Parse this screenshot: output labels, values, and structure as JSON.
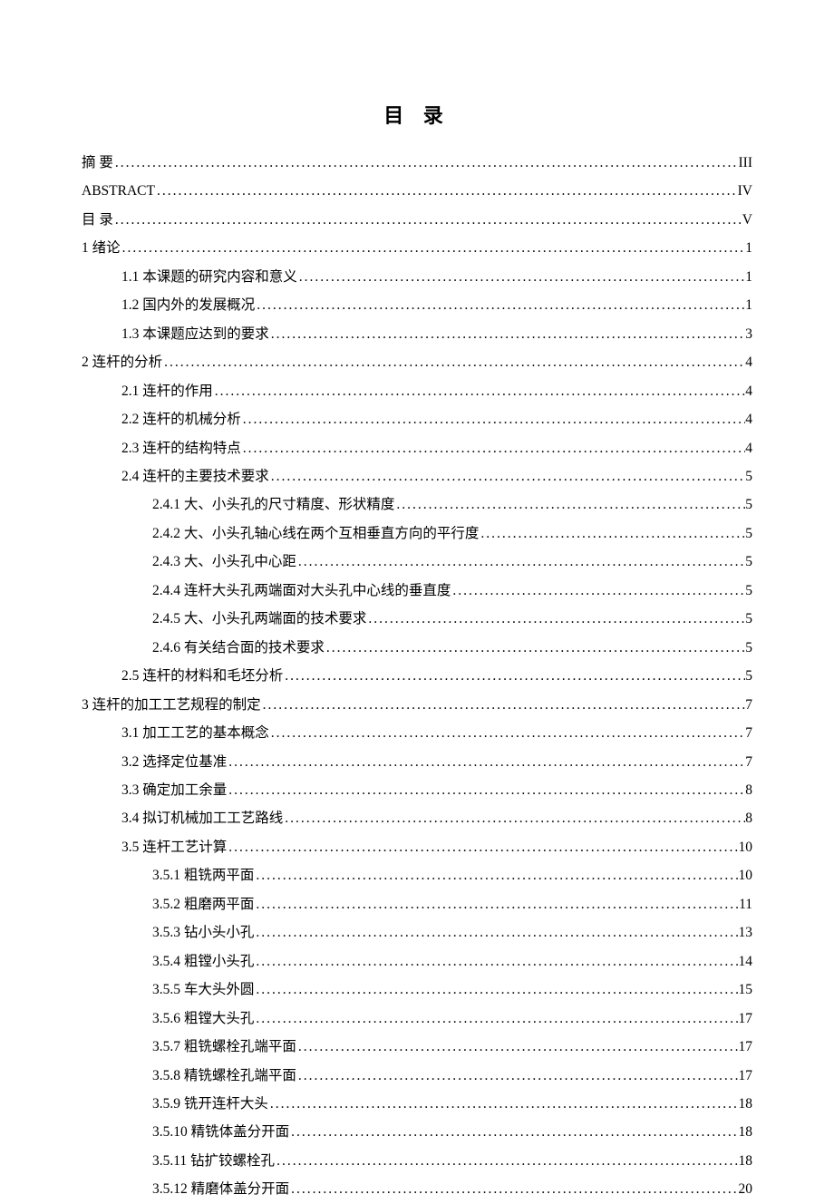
{
  "heading": "目  录",
  "toc": [
    {
      "level": 0,
      "title": "摘    要",
      "page": "III"
    },
    {
      "level": 0,
      "title": "ABSTRACT",
      "page": "IV"
    },
    {
      "level": 0,
      "title": "目    录",
      "page": "V"
    },
    {
      "level": 0,
      "title": "1  绪论",
      "page": "1"
    },
    {
      "level": 1,
      "title": "1.1  本课题的研究内容和意义",
      "page": "1"
    },
    {
      "level": 1,
      "title": "1.2  国内外的发展概况",
      "page": "1"
    },
    {
      "level": 1,
      "title": "1.3  本课题应达到的要求",
      "page": "3"
    },
    {
      "level": 0,
      "title": "2  连杆的分析",
      "page": "4"
    },
    {
      "level": 1,
      "title": "2.1  连杆的作用",
      "page": "4"
    },
    {
      "level": 1,
      "title": "2.2  连杆的机械分析",
      "page": "4"
    },
    {
      "level": 1,
      "title": "2.3  连杆的结构特点",
      "page": "4"
    },
    {
      "level": 1,
      "title": "2.4 连杆的主要技术要求",
      "page": "5"
    },
    {
      "level": 2,
      "title": "2.4.1  大、小头孔的尺寸精度、形状精度",
      "page": "5"
    },
    {
      "level": 2,
      "title": "2.4.2  大、小头孔轴心线在两个互相垂直方向的平行度",
      "page": "5"
    },
    {
      "level": 2,
      "title": "2.4.3  大、小头孔中心距",
      "page": "5"
    },
    {
      "level": 2,
      "title": "2.4.4  连杆大头孔两端面对大头孔中心线的垂直度",
      "page": "5"
    },
    {
      "level": 2,
      "title": "2.4.5  大、小头孔两端面的技术要求",
      "page": "5"
    },
    {
      "level": 2,
      "title": "2.4.6  有关结合面的技术要求",
      "page": "5"
    },
    {
      "level": 1,
      "title": "2.5  连杆的材料和毛坯分析",
      "page": "5"
    },
    {
      "level": 0,
      "title": "3  连杆的加工工艺规程的制定",
      "page": "7"
    },
    {
      "level": 1,
      "title": "3.1  加工工艺的基本概念",
      "page": "7"
    },
    {
      "level": 1,
      "title": "3.2  选择定位基准",
      "page": "7"
    },
    {
      "level": 1,
      "title": "3.3  确定加工余量",
      "page": "8"
    },
    {
      "level": 1,
      "title": "3.4  拟订机械加工工艺路线",
      "page": "8"
    },
    {
      "level": 1,
      "title": "3.5  连杆工艺计算",
      "page": "10"
    },
    {
      "level": 2,
      "title": "3.5.1  粗铣两平面",
      "page": "10"
    },
    {
      "level": 2,
      "title": "3.5.2  粗磨两平面",
      "page": "11"
    },
    {
      "level": 2,
      "title": "3.5.3  钻小头小孔",
      "page": "13"
    },
    {
      "level": 2,
      "title": "3.5.4  粗镗小头孔",
      "page": "14"
    },
    {
      "level": 2,
      "title": "3.5.5  车大头外圆",
      "page": "15"
    },
    {
      "level": 2,
      "title": "3.5.6  粗镗大头孔",
      "page": "17"
    },
    {
      "level": 2,
      "title": "3.5.7  粗铣螺栓孔端平面",
      "page": "17"
    },
    {
      "level": 2,
      "title": "3.5.8  精铣螺栓孔端平面",
      "page": "17"
    },
    {
      "level": 2,
      "title": "3.5.9  铣开连杆大头",
      "page": "18"
    },
    {
      "level": 2,
      "title": "3.5.10  精铣体盖分开面",
      "page": "18"
    },
    {
      "level": 2,
      "title": "3.5.11  钻扩铰螺栓孔",
      "page": "18"
    },
    {
      "level": 2,
      "title": "3.5.12  精磨体盖分开面",
      "page": "20"
    }
  ]
}
